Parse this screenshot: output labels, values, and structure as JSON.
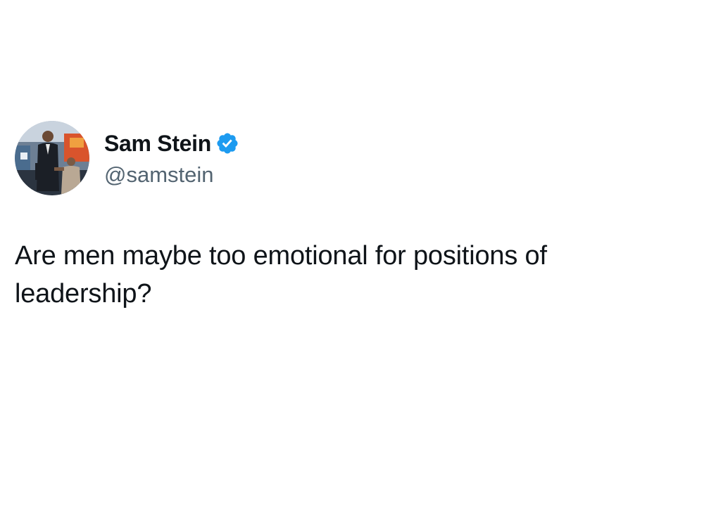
{
  "tweet": {
    "author": {
      "display_name": "Sam Stein",
      "handle": "@samstein",
      "verified": true,
      "verified_icon": "verified-badge-icon",
      "avatar": "avatar-photo"
    },
    "text": "Are men maybe too emotional for positions of leadership?"
  },
  "colors": {
    "text_primary": "#0f1419",
    "text_secondary": "#536471",
    "verified_blue": "#1d9bf0",
    "background": "#ffffff"
  }
}
